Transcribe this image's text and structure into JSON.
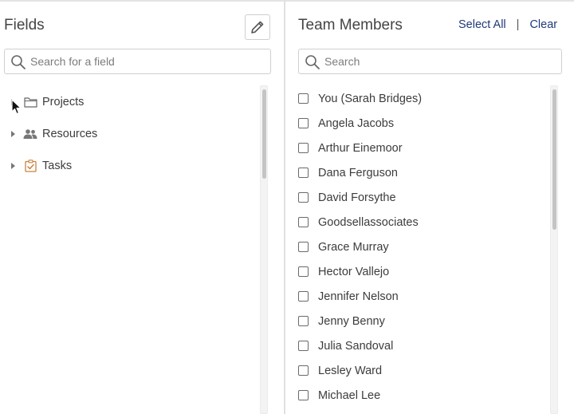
{
  "fields_panel": {
    "title": "Fields",
    "edit_icon": "pencil-icon",
    "search": {
      "placeholder": "Search for a field",
      "value": ""
    },
    "tree": [
      {
        "label": "Projects",
        "icon": "folder-icon",
        "expanded": false
      },
      {
        "label": "Resources",
        "icon": "people-icon",
        "expanded": false
      },
      {
        "label": "Tasks",
        "icon": "task-checklist-icon",
        "expanded": false
      }
    ]
  },
  "team_panel": {
    "title": "Team Members",
    "select_all": "Select All",
    "separator": "|",
    "clear": "Clear",
    "search": {
      "placeholder": "Search",
      "value": ""
    },
    "members": [
      "You (Sarah Bridges)",
      "Angela Jacobs",
      "Arthur Einemoor",
      "Dana Ferguson",
      "David Forsythe",
      "Goodsellassociates",
      "Grace Murray",
      "Hector Vallejo",
      "Jennifer Nelson",
      "Jenny Benny",
      "Julia Sandoval",
      "Lesley Ward",
      "Michael Lee"
    ]
  },
  "colors": {
    "link": "#1f3a7a",
    "task_icon": "#c9833e",
    "border": "#cfcfcf"
  }
}
